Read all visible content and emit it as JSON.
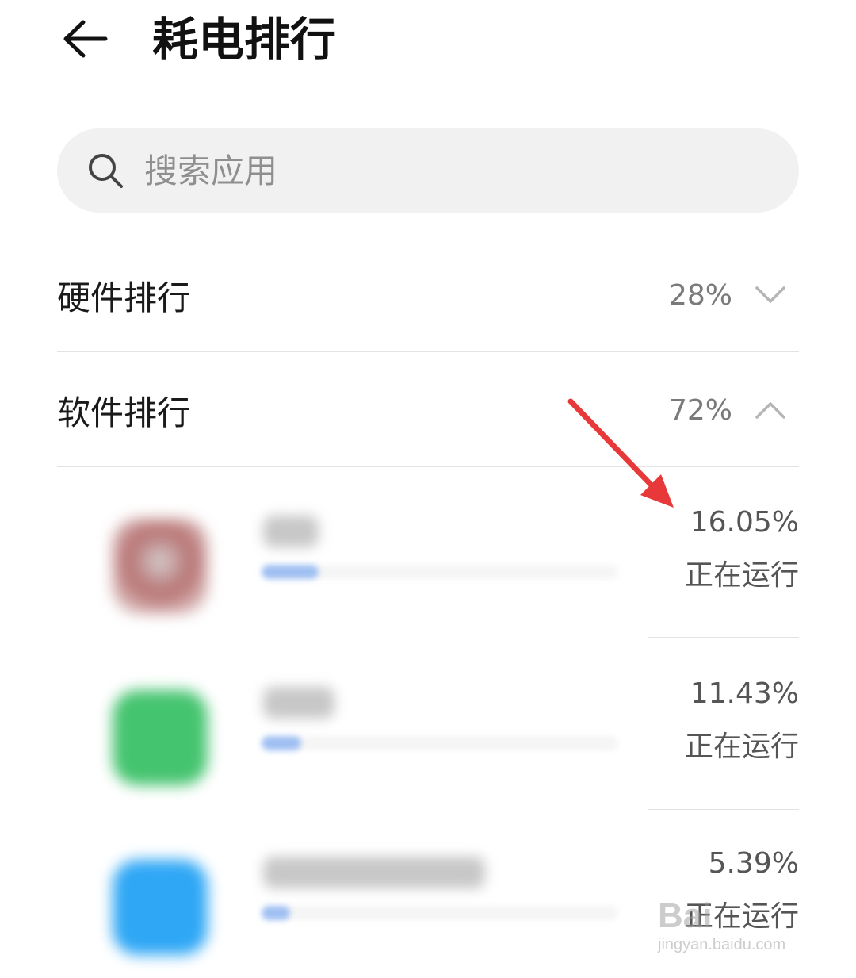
{
  "header": {
    "title": "耗电排行",
    "back_icon": "back-arrow-icon"
  },
  "search": {
    "placeholder": "搜索应用",
    "icon": "search-icon"
  },
  "sections": [
    {
      "label": "硬件排行",
      "percent": "28%",
      "expanded": false,
      "chevron": "chevron-down-icon"
    },
    {
      "label": "软件排行",
      "percent": "72%",
      "expanded": true,
      "chevron": "chevron-up-icon"
    }
  ],
  "apps": [
    {
      "percent": "16.05%",
      "status": "正在运行",
      "usage_fraction": 0.16,
      "icon_color": "#c05a5a"
    },
    {
      "percent": "11.43%",
      "status": "正在运行",
      "usage_fraction": 0.11,
      "icon_color": "#3cc36a"
    },
    {
      "percent": "5.39%",
      "status": "正在运行",
      "usage_fraction": 0.05,
      "icon_color": "#2a9df4"
    }
  ],
  "annotation": {
    "color": "#e8393a"
  },
  "watermark": {
    "main": "Bai",
    "sub": "jingyan.baidu.com"
  }
}
